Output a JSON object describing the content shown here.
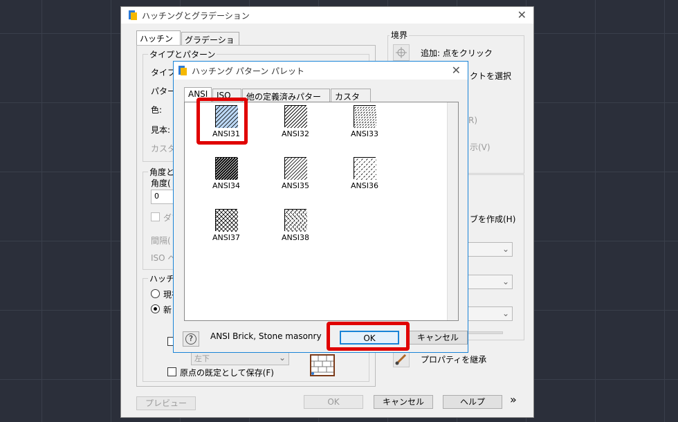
{
  "main_dialog": {
    "title": "ハッチングとグラデーション",
    "tabs": [
      "ハッチング",
      "グラデーション"
    ],
    "group_type_pattern": "タイプとパターン",
    "label_type": "タイプ(",
    "label_pattern": "パター",
    "label_color": "色:",
    "label_swatch": "見本:",
    "label_custom": "カスタ",
    "group_angle": "角度と",
    "label_angle": "角度(",
    "angle_value": "0",
    "label_double": "ダブ",
    "label_spacing": "間隔(",
    "label_iso": "ISO ペ",
    "group_origin": "ハッチ",
    "radio_current": "現在",
    "radio_new": "新し",
    "combo_position": "左下",
    "check_save_origin": "原点の既定として保存(F)",
    "boundary": "境界",
    "add_pick": "追加: 点をクリック",
    "select_objects": "クトを選択",
    "remove_partial": "R)",
    "show_partial": "示(V)",
    "create_partial": "ブを作成(H)",
    "inherit_props": "プロパティを継承",
    "preview": "プレビュー",
    "ok": "OK",
    "cancel": "キャンセル",
    "help": "ヘルプ",
    "expand": "»"
  },
  "palette": {
    "title": "ハッチング パターン パレット",
    "tabs": [
      "ANSI",
      "ISO",
      "他の定義済みパターン",
      "カスタム"
    ],
    "patterns": [
      "ANSI31",
      "ANSI32",
      "ANSI33",
      "ANSI34",
      "ANSI35",
      "ANSI36",
      "ANSI37",
      "ANSI38"
    ],
    "description": "ANSI Brick, Stone masonry",
    "help_icon": "?",
    "ok": "OK",
    "cancel": "キャンセル"
  },
  "colors": {
    "highlight": "#e00000",
    "selected_swatch": "#bcd8f5",
    "title_accent": "#1883d7"
  }
}
